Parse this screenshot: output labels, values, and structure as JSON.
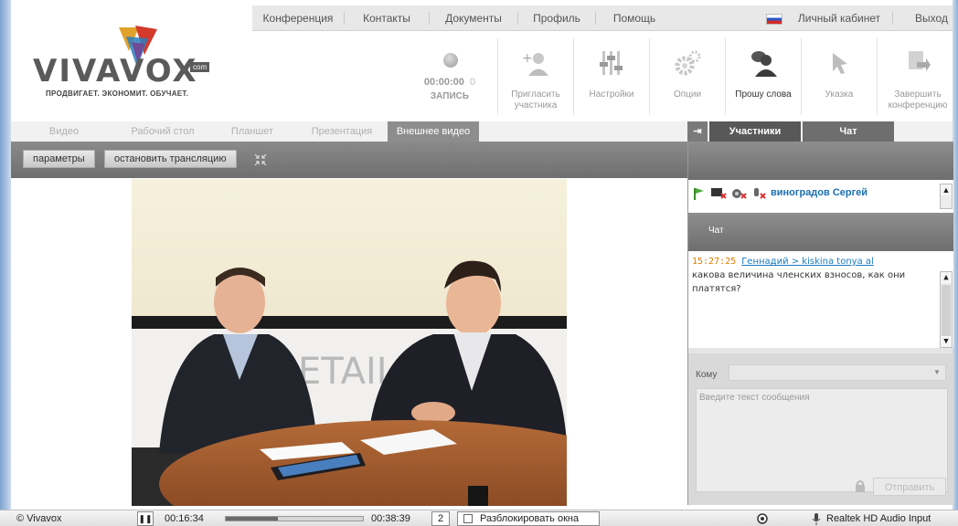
{
  "nav": {
    "items": [
      "Конференция",
      "Контакты",
      "Документы",
      "Профиль",
      "Помощь"
    ],
    "cabinet": "Личный кабинет",
    "logout": "Выход",
    "flag_icon": "russia-flag-icon"
  },
  "logo": {
    "word": "VIVAVOX",
    "com": "com",
    "tagline": "ПРОДВИГАЕТ. ЭКОНОМИТ. ОБУЧАЕТ."
  },
  "recording": {
    "time": "00:00:00",
    "count": "0",
    "label": "ЗАПИСЬ"
  },
  "toolbar": {
    "invite": "Пригласить участника",
    "settings": "Настройки",
    "options": "Опции",
    "ask_word": "Прошу слова",
    "pointer": "Указка",
    "end": "Завершить конференцию"
  },
  "tabs": [
    "Видео",
    "Рабочий стол",
    "Планшет",
    "Презентация",
    "Внешнее видео"
  ],
  "active_tab": "Внешнее видео",
  "right_tabs": {
    "participants": "Участники",
    "chat": "Чат"
  },
  "strip": {
    "params": "параметры",
    "stop": "остановить трансляцию"
  },
  "video": {
    "sign_text": "ETAIL.R"
  },
  "participants": [
    {
      "name": "виноградов Сергей"
    }
  ],
  "chat": {
    "header": "Чат",
    "time": "15:27:25",
    "route": "Геннадий > kiskina tonya al",
    "line1": "какова величина членских взносов, как они",
    "line2": "платятся?"
  },
  "compose": {
    "to_label": "Кому",
    "placeholder": "Введите текст сообщения",
    "send": "Отправить"
  },
  "statusbar": {
    "app": "© Vivavox",
    "elapsed": "00:16:34",
    "total": "00:38:39",
    "page": "2",
    "unlock": "Разблокировать окна",
    "audio": "Realtek HD Audio Input",
    "progress": 0.38
  },
  "colors": {
    "name_blue": "#1b6fb2",
    "time_orange": "#e07b00",
    "route_blue": "#1a7bbf",
    "route_red": "#c0282c"
  }
}
